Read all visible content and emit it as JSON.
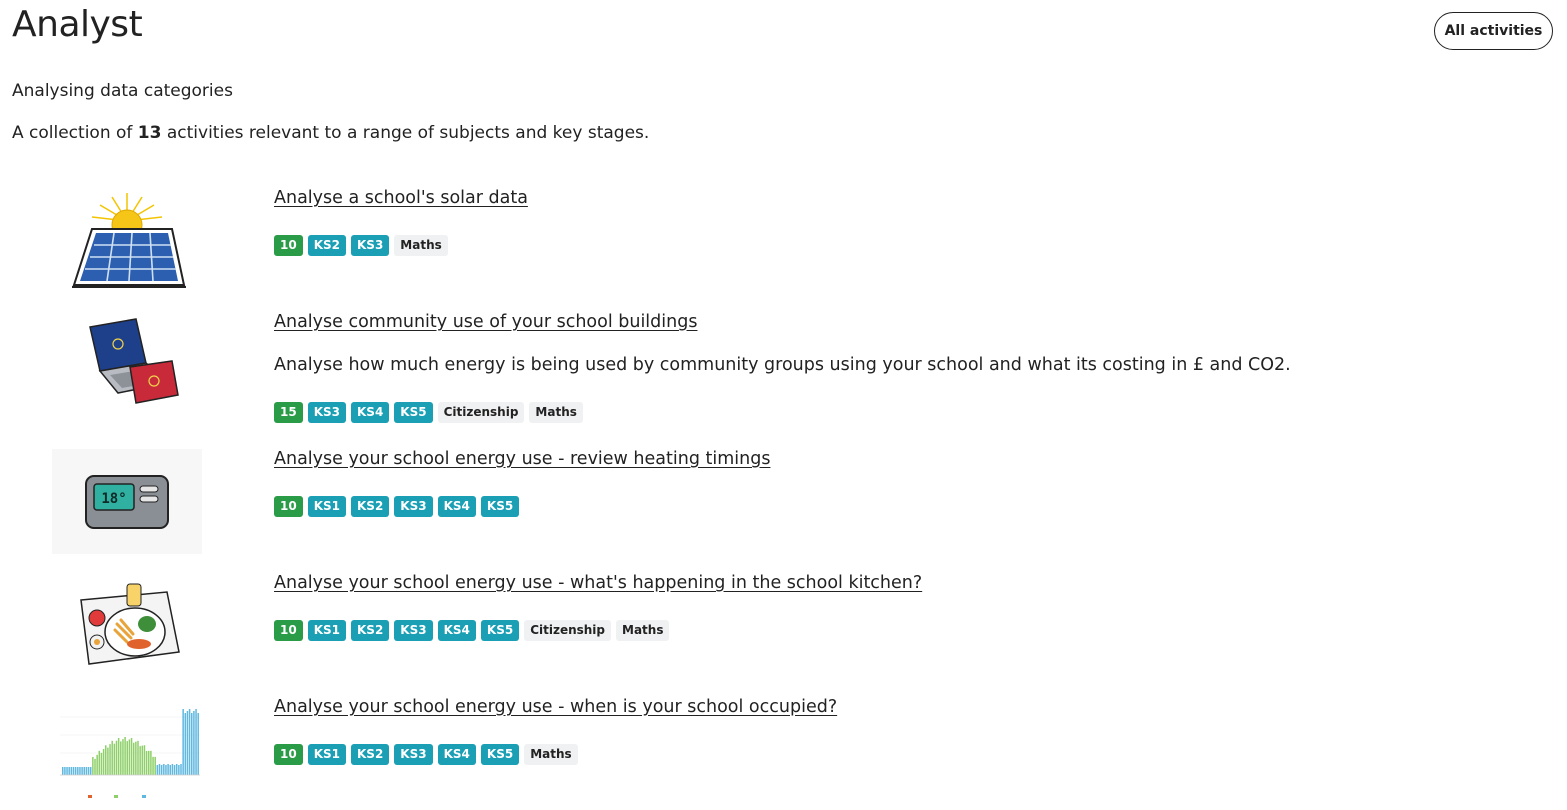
{
  "header": {
    "title": "Analyst",
    "all_activities_label": "All activities"
  },
  "subtitle": "Analysing data categories",
  "summary": {
    "prefix": "A collection of ",
    "count": "13",
    "suffix": " activities relevant to a range of subjects and key stages."
  },
  "activities": [
    {
      "title": "Analyse a school's solar data",
      "description": "",
      "score": "10",
      "key_stages": [
        "KS2",
        "KS3"
      ],
      "subjects": [
        "Maths"
      ],
      "image": "solar-panel-icon"
    },
    {
      "title": "Analyse community use of your school buildings",
      "description": "Analyse how much energy is being used by community groups using your school and what its costing in £ and CO2.",
      "score": "15",
      "key_stages": [
        "KS3",
        "KS4",
        "KS5"
      ],
      "subjects": [
        "Citizenship",
        "Maths"
      ],
      "image": "laptop-tablet-icon"
    },
    {
      "title": "Analyse your school energy use - review heating timings",
      "description": "",
      "score": "10",
      "key_stages": [
        "KS1",
        "KS2",
        "KS3",
        "KS4",
        "KS5"
      ],
      "subjects": [],
      "image": "thermostat-icon",
      "thermostat_reading": "18°"
    },
    {
      "title": "Analyse your school energy use - what's happening in the school kitchen?",
      "description": "",
      "score": "10",
      "key_stages": [
        "KS1",
        "KS2",
        "KS3",
        "KS4",
        "KS5"
      ],
      "subjects": [
        "Citizenship",
        "Maths"
      ],
      "image": "lunch-tray-icon"
    },
    {
      "title": "Analyse your school energy use - when is your school occupied?",
      "description": "",
      "score": "10",
      "key_stages": [
        "KS1",
        "KS2",
        "KS3",
        "KS4",
        "KS5"
      ],
      "subjects": [
        "Maths"
      ],
      "image": "occupancy-chart-icon"
    }
  ],
  "colors": {
    "score_badge": "#2a9c47",
    "key_stage_badge": "#1a9fb5",
    "subject_badge": "#f0f1f2"
  }
}
